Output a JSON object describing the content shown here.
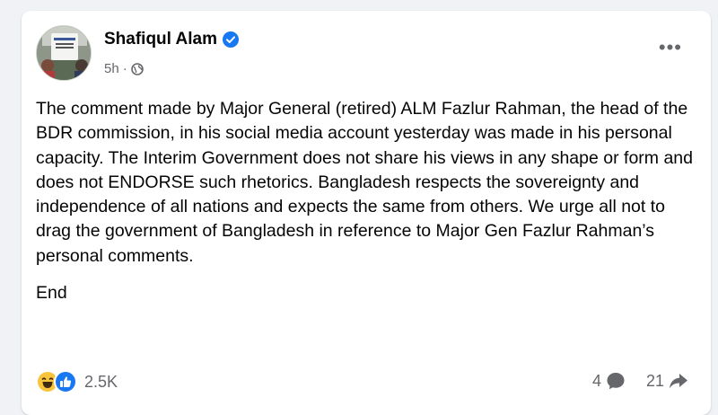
{
  "post": {
    "author": "Shafiqul Alam",
    "time": "5h",
    "separator": "·",
    "more_label": "•••",
    "paragraphs": [
      "The comment made by Major General (retired) ALM Fazlur Rahman, the head of the BDR commission, in his social media account yesterday was made in his personal capacity. The Interim Government does not share his views in any shape or form and does not ENDORSE such rhetorics. Bangladesh respects the sovereignty and independence of all nations and expects the same from others. We urge all not to drag the government of Bangladesh in reference to Major Gen Fazlur Rahman’s personal comments.",
      "End"
    ]
  },
  "footer": {
    "reaction_count": "2.5K",
    "reaction_icons": [
      "haha-icon",
      "like-icon"
    ],
    "comments_count": "4",
    "shares_count": "21"
  },
  "colors": {
    "verified": "#1877f2",
    "secondary_text": "#65676b",
    "primary_text": "#050505",
    "like": "#1877f2",
    "haha": "#f7c43b"
  }
}
